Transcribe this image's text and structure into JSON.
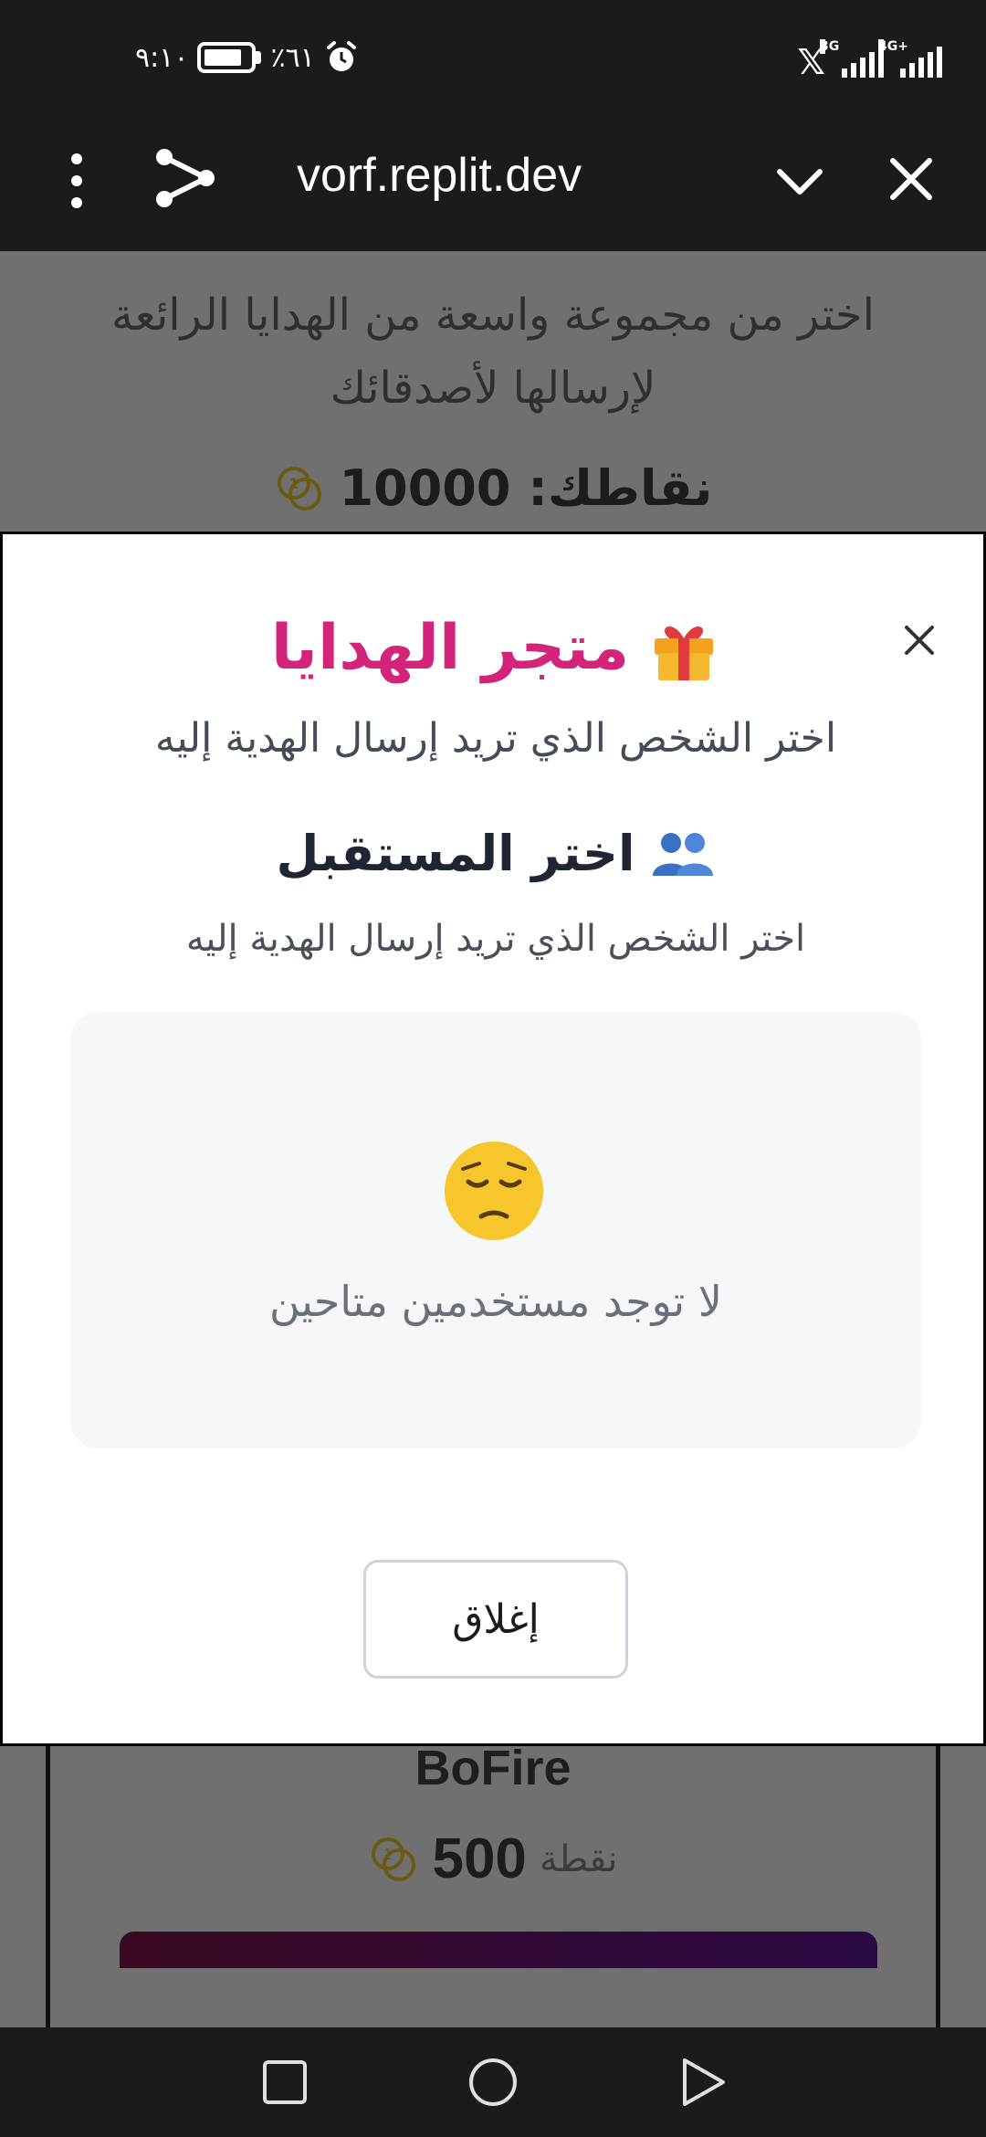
{
  "status_bar": {
    "time": "٩:١٠",
    "battery_percent": "٪٦١",
    "carrier_icon": "x-icon",
    "network_1": "3G",
    "network_2": "4G+"
  },
  "browser": {
    "url": "vorf.replit.dev"
  },
  "background_page": {
    "description": "اختر من مجموعة واسعة من الهدايا الرائعة لإرسالها لأصدقائك",
    "points_label": "نقاطك: 10000",
    "card": {
      "name": "BoFire",
      "price_value": "500",
      "price_unit": "نقطة"
    }
  },
  "modal": {
    "title": "متجر الهدايا",
    "subtitle": "اختر الشخص الذي تريد إرسال الهدية إليه",
    "section_title": "اختر المستقبل",
    "section_subtitle": "اختر الشخص الذي تريد إرسال الهدية إليه",
    "empty_message": "لا توجد مستخدمين متاحين",
    "close_button": "إغلاق"
  },
  "colors": {
    "title_accent": "#d4237a",
    "coin": "#c9a20f"
  }
}
